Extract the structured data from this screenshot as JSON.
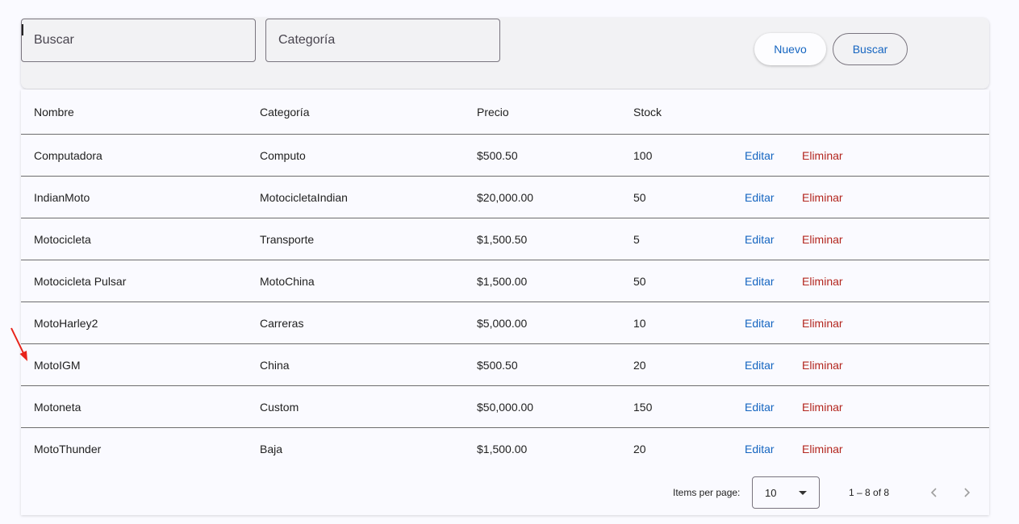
{
  "filters": {
    "search_placeholder": "Buscar",
    "category_placeholder": "Categoría",
    "new_button": "Nuevo",
    "search_button": "Buscar"
  },
  "table": {
    "columns": [
      "Nombre",
      "Categoría",
      "Precio",
      "Stock"
    ],
    "edit_label": "Editar",
    "delete_label": "Eliminar",
    "rows": [
      {
        "nombre": "Computadora",
        "categoria": "Computo",
        "precio": "$500.50",
        "stock": "100"
      },
      {
        "nombre": "IndianMoto",
        "categoria": "MotocicletaIndian",
        "precio": "$20,000.00",
        "stock": "50"
      },
      {
        "nombre": "Motocicleta",
        "categoria": "Transporte",
        "precio": "$1,500.50",
        "stock": "5"
      },
      {
        "nombre": "Motocicleta Pulsar",
        "categoria": "MotoChina",
        "precio": "$1,500.00",
        "stock": "50"
      },
      {
        "nombre": "MotoHarley2",
        "categoria": "Carreras",
        "precio": "$5,000.00",
        "stock": "10"
      },
      {
        "nombre": "MotoIGM",
        "categoria": "China",
        "precio": "$500.50",
        "stock": "20"
      },
      {
        "nombre": "Motoneta",
        "categoria": "Custom",
        "precio": "$50,000.00",
        "stock": "150"
      },
      {
        "nombre": "MotoThunder",
        "categoria": "Baja",
        "precio": "$1,500.00",
        "stock": "20"
      }
    ]
  },
  "paginator": {
    "items_per_page_label": "Items per page:",
    "page_size": "10",
    "range_label": "1 – 8 of 8"
  },
  "colors": {
    "link_blue": "#1565c0",
    "delete_red": "#b3261e",
    "annotation_arrow": "#e8231a"
  },
  "icons": {
    "page_size": "chevron-down-icon",
    "previous": "chevron-left-icon",
    "next": "chevron-right-icon"
  }
}
